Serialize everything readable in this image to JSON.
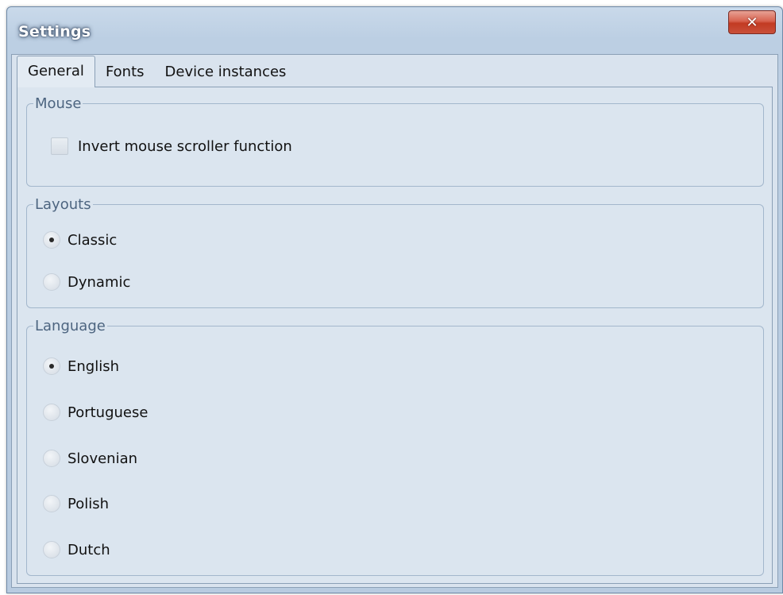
{
  "window": {
    "title": "Settings",
    "close_glyph": "✕"
  },
  "tabs": [
    {
      "label": "General",
      "active": true
    },
    {
      "label": "Fonts",
      "active": false
    },
    {
      "label": "Device instances",
      "active": false
    }
  ],
  "mouse": {
    "legend": "Mouse",
    "invert_scroller": {
      "label": "Invert mouse scroller function",
      "checked": false
    }
  },
  "layouts": {
    "legend": "Layouts",
    "options": [
      {
        "label": "Classic",
        "selected": true
      },
      {
        "label": "Dynamic",
        "selected": false
      }
    ]
  },
  "language": {
    "legend": "Language",
    "options": [
      {
        "label": "English",
        "selected": true
      },
      {
        "label": "Portuguese",
        "selected": false
      },
      {
        "label": "Slovenian",
        "selected": false
      },
      {
        "label": "Polish",
        "selected": false
      },
      {
        "label": "Dutch",
        "selected": false
      }
    ]
  },
  "colors": {
    "title_bar": "#bccfe3",
    "close_button": "#c9503a",
    "panel_background": "#dbe5ef",
    "group_legend_text": "#4d6580"
  }
}
